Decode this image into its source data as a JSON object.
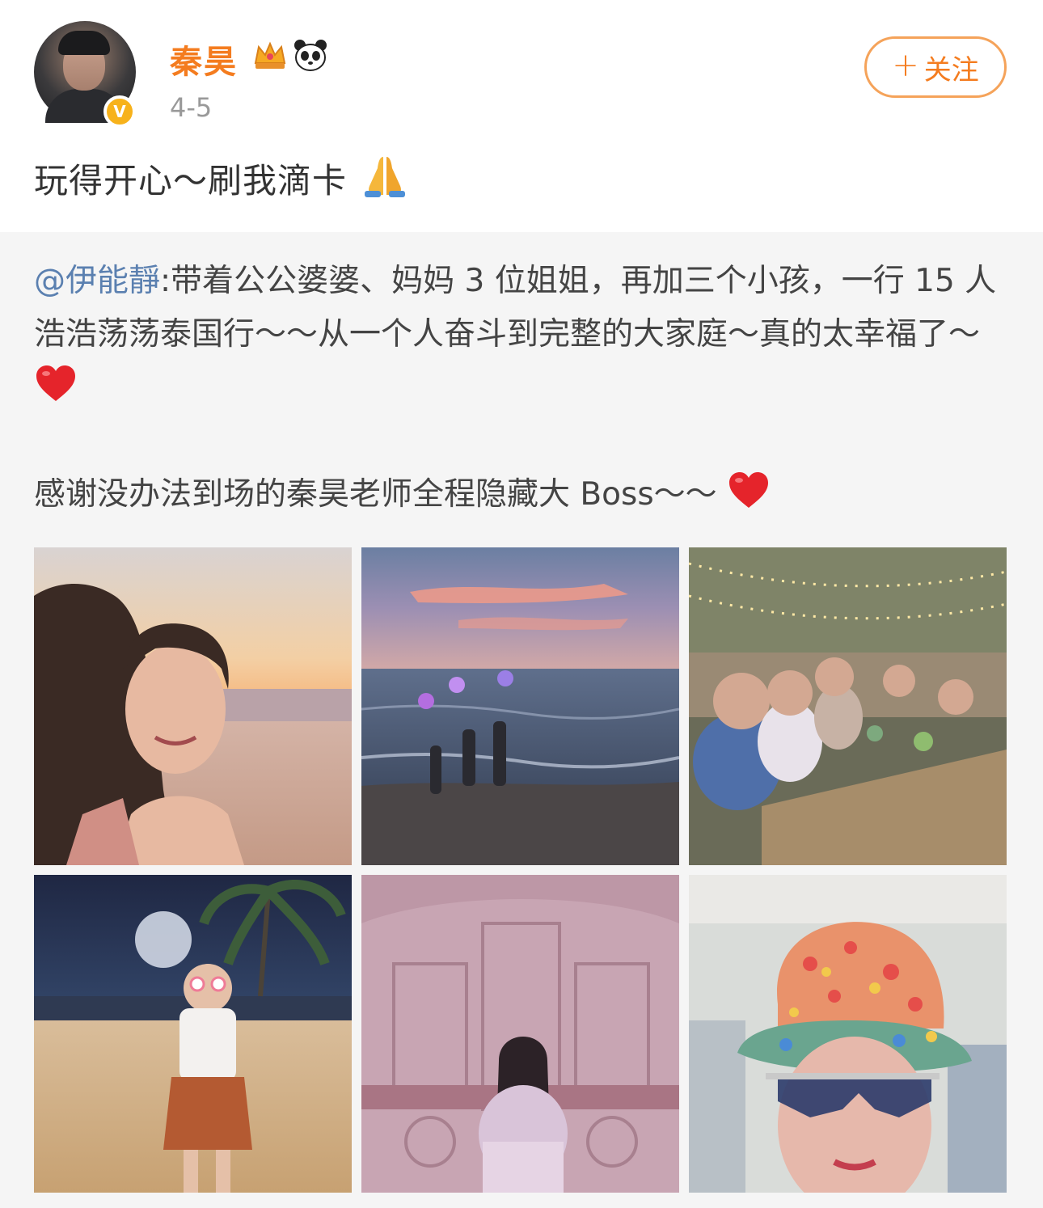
{
  "user": {
    "name": "秦昊",
    "date": "4-5",
    "verified_badge": "V",
    "badges": [
      "crown-badge-icon",
      "panda-badge-icon"
    ]
  },
  "follow_button": {
    "plus": "+",
    "label": "关注"
  },
  "post": {
    "text": "玩得开心～刷我滴卡",
    "emoji": "folded-hands-emoji"
  },
  "repost": {
    "mention": "@伊能靜",
    "line1": ":带着公公婆婆、妈妈 3 位姐姐，再加三个小孩，一行 15 人浩浩荡荡泰国行～～从一个人奋斗到完整的大家庭～真的太幸福了～",
    "line2": "感谢没办法到场的秦昊老师全程隐藏大 Boss～～",
    "emoji": "red-heart-emoji"
  },
  "photos": [
    {
      "name": "selfie-beach-sunset"
    },
    {
      "name": "kids-sea-sunset"
    },
    {
      "name": "family-dinner"
    },
    {
      "name": "girl-beach-night"
    },
    {
      "name": "woman-pink-room"
    },
    {
      "name": "woman-bucket-hat"
    }
  ],
  "colors": {
    "accent": "#f47c1f",
    "mention": "#5b80b0",
    "repost_bg": "#f5f5f5"
  }
}
